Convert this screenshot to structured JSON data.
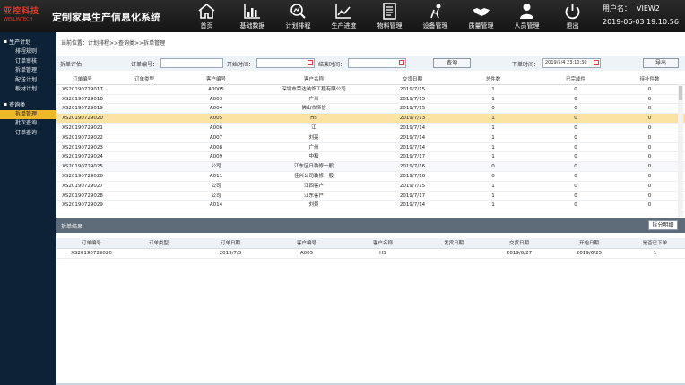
{
  "logo": {
    "line1": "亚控科技",
    "line2": "WELLINTECH"
  },
  "app_title": "定制家具生产信息化系统",
  "nav": [
    {
      "label": "首页",
      "icon": "home-icon"
    },
    {
      "label": "基础数据",
      "icon": "bar-chart-icon"
    },
    {
      "label": "计划排程",
      "icon": "search-chart-icon"
    },
    {
      "label": "生产进度",
      "icon": "trend-chart-icon"
    },
    {
      "label": "物料管理",
      "icon": "document-icon"
    },
    {
      "label": "设备管理",
      "icon": "equipment-icon"
    },
    {
      "label": "质量管理",
      "icon": "handshake-icon"
    },
    {
      "label": "人员管理",
      "icon": "person-icon"
    },
    {
      "label": "退出",
      "icon": "power-icon"
    }
  ],
  "user": {
    "label": "用户名：",
    "name": "VIEW2",
    "datetime": "2019-06-03 19:10:56"
  },
  "sidebar": {
    "group1": "生产计划",
    "group1_items": [
      "排程规则",
      "订单审核",
      "拆单管理",
      "配送计划",
      "板材计划"
    ],
    "group2": "查询类",
    "group2_items": [
      "拆单管理",
      "批次查询",
      "订单查询"
    ]
  },
  "breadcrumb": "当前位置：计划排程>>查询类>>拆单管理",
  "filter": {
    "title": "拆单评估",
    "order_no_label": "订单编号：",
    "order_no_value": "",
    "start_label": "开始时间：",
    "start_value": "",
    "end_label": "结束时间：",
    "end_value": "",
    "query_button": "查询",
    "issue_label": "下单时间：",
    "issue_value": "2019/5/4 23:10:30",
    "export_button": "导出"
  },
  "grid": {
    "headers": [
      "订单编号",
      "订单类型",
      "客户编号",
      "客户名称",
      "交货日期",
      "总件数",
      "已完成件",
      "待补件数"
    ],
    "rows": [
      [
        "XS20190729017",
        "",
        "A0005",
        "深圳市荣达装饰工程有限公司",
        "2019/7/15",
        "1",
        "0",
        "0"
      ],
      [
        "XS20190729018",
        "",
        "A003",
        "广州",
        "2019/7/15",
        "1",
        "0",
        "0"
      ],
      [
        "XS20190729019",
        "",
        "A004",
        "佛山市恒信",
        "2019/7/15",
        "0",
        "0",
        "0"
      ],
      [
        "XS20190729020",
        "",
        "A005",
        "HS",
        "2019/7/13",
        "1",
        "0",
        "0"
      ],
      [
        "XS20190729021",
        "",
        "A006",
        "江",
        "2019/7/14",
        "1",
        "0",
        "0"
      ],
      [
        "XS20190729022",
        "",
        "A007",
        "刘亮",
        "2019/7/14",
        "1",
        "0",
        "0"
      ],
      [
        "XS20190729023",
        "",
        "A008",
        "广州",
        "2019/7/14",
        "1",
        "0",
        "0"
      ],
      [
        "XS20190729024",
        "",
        "A009",
        "中和",
        "2019/7/17",
        "1",
        "0",
        "0"
      ],
      [
        "XS20190729025",
        "",
        "公司",
        "江东区日装修一般",
        "2019/7/16",
        "0",
        "0",
        "0"
      ],
      [
        "XS20190729026",
        "",
        "A011",
        "佳兴公司装修一般",
        "2019/7/16",
        "0",
        "0",
        "0"
      ],
      [
        "XS20190729027",
        "",
        "公司",
        "江西客户",
        "2019/7/15",
        "1",
        "0",
        "0"
      ],
      [
        "XS20190729028",
        "",
        "公司",
        "江东客户",
        "2019/7/17",
        "1",
        "0",
        "0"
      ],
      [
        "XS20190729029",
        "",
        "A014",
        "刘景",
        "2019/7/14",
        "1",
        "0",
        "0"
      ]
    ]
  },
  "section2": {
    "title": "拆单结果",
    "button": "拆分明细"
  },
  "grid2": {
    "headers": [
      "订单编号",
      "订单类型",
      "订单日期",
      "客户编号",
      "客户名称",
      "发货日期",
      "交货日期",
      "开始日期",
      "是否已下单"
    ],
    "rows": [
      [
        "XS20190729020",
        "",
        "2019/7/5",
        "A005",
        "HS",
        "",
        "2019/6/27",
        "2019/6/25",
        "1"
      ]
    ]
  },
  "colors": {
    "topbar": "#1e1e1e",
    "sidebar": "#0d2236",
    "selected_row": "#fbe3a4",
    "active_sidebar": "#f0b828",
    "section_bar": "#5e6b78"
  }
}
